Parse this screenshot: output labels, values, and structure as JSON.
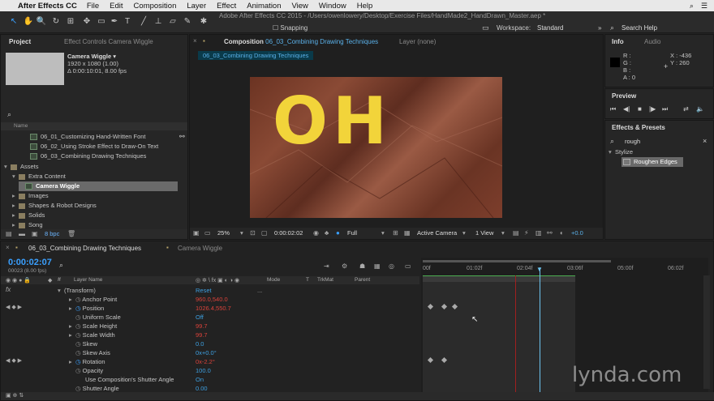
{
  "menubar": {
    "app_name": "After Effects CC",
    "items": [
      "File",
      "Edit",
      "Composition",
      "Layer",
      "Effect",
      "Animation",
      "View",
      "Window",
      "Help"
    ]
  },
  "window_title": "Adobe After Effects CC 2015 - /Users/owenlowery/Desktop/Exercise Files/HandMade2_HandDrawn_Master.aep *",
  "toolbar": {
    "snapping": "Snapping",
    "workspace_label": "Workspace:",
    "workspace_value": "Standard",
    "search_help": "Search Help"
  },
  "project": {
    "tab": "Project",
    "effect_controls_tab": "Effect Controls Camera Wiggle",
    "item_name": "Camera Wiggle ▾",
    "item_info1": "1920 x 1080 (1.00)",
    "item_info2": "Δ 0:00:10:01, 8.00 fps",
    "col_name": "Name",
    "rows": [
      {
        "label": "06_01_Customizing Hand-Written Font"
      },
      {
        "label": "06_02_Using Stroke Effect to Draw-On Text"
      },
      {
        "label": "06_03_Combining Drawing Techniques"
      },
      {
        "label": "Assets"
      },
      {
        "label": "Extra Content"
      },
      {
        "label": "Camera Wiggle"
      },
      {
        "label": "Images"
      },
      {
        "label": "Shapes & Robot Designs"
      },
      {
        "label": "Solids"
      },
      {
        "label": "Song"
      }
    ],
    "bpc": "8 bpc"
  },
  "composition": {
    "tab_prefix": "Composition",
    "tab_name": "06_03_Combining Drawing Techniques",
    "layer_tab": "Layer (none)",
    "comp_label": "06_03_Combining Drawing Techniques",
    "canvas_text": "OH",
    "zoom": "25%",
    "timecode": "0:00:02:02",
    "resolution": "Full",
    "camera": "Active Camera",
    "view": "1 View",
    "exposure": "+0.0"
  },
  "info": {
    "tab": "Info",
    "audio_tab": "Audio",
    "r": "R :",
    "g": "G :",
    "b": "B :",
    "a": "A : 0",
    "x": "X : -436",
    "y": "Y : 260"
  },
  "preview": {
    "tab": "Preview"
  },
  "effects": {
    "tab": "Effects & Presets",
    "search_value": "rough",
    "category": "Stylize",
    "item": "Roughen Edges"
  },
  "timeline": {
    "tab1": "06_03_Combining Drawing Techniques",
    "tab2": "Camera Wiggle",
    "current_time": "0:00:02:07",
    "frame_info": "00023 (8.00 fps)",
    "col_layer_name": "Layer Name",
    "col_mode": "Mode",
    "col_t": "T",
    "col_trkmat": "TrkMat",
    "col_parent": "Parent",
    "ruler": [
      "00f",
      "01:02f",
      "02:04f",
      "03:06f",
      "05:00f",
      "06:02f"
    ],
    "props": [
      {
        "name": "(Transform)",
        "value": "Reset"
      },
      {
        "name": "Anchor Point",
        "value": "960.0,540.0"
      },
      {
        "name": "Position",
        "value": "1026.4,550.7"
      },
      {
        "name": "Uniform Scale",
        "value": "Off"
      },
      {
        "name": "Scale Height",
        "value": "99.7"
      },
      {
        "name": "Scale Width",
        "value": "99.7"
      },
      {
        "name": "Skew",
        "value": "0.0"
      },
      {
        "name": "Skew Axis",
        "value": "0x+0.0°"
      },
      {
        "name": "Rotation",
        "value": "0x-2.2°"
      },
      {
        "name": "Opacity",
        "value": "100.0"
      },
      {
        "name": "Use Composition's Shutter Angle",
        "value": "On"
      },
      {
        "name": "Shutter Angle",
        "value": "0.00"
      }
    ]
  },
  "watermark": "lynda.com"
}
